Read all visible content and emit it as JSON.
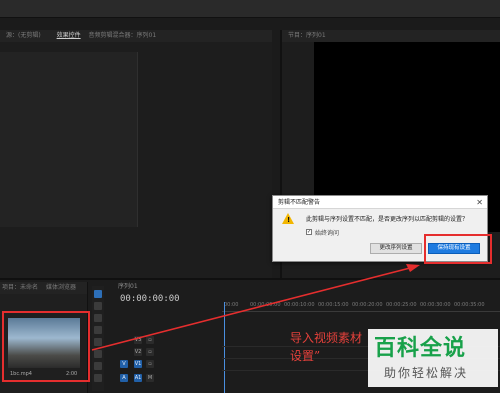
{
  "source_panel": {
    "tabs": [
      "效果控件",
      "音频剪辑混合器：序列01"
    ],
    "left_label": "源：(无剪辑)"
  },
  "program_panel": {
    "title": "节目：序列01"
  },
  "dialog": {
    "title": "剪辑不匹配警告",
    "close": "✕",
    "message": "此剪辑与序列设置不匹配，是否更改序列以匹配剪辑的设置？",
    "checkbox_label": "始终询问",
    "checkbox_checked": true,
    "btn_change": "更改序列设置",
    "btn_keep": "保持现有设置"
  },
  "project_panel": {
    "title": "项目：未命名",
    "tab2": "媒体浏览器",
    "clip_name": "1bc.mp4",
    "clip_duration": "2:00"
  },
  "timeline": {
    "title": "序列01",
    "timecode": "00:00:00:00",
    "ruler": [
      "00:00",
      "00:00:05:00",
      "00:00:10:00",
      "00:00:15:00",
      "00:00:20:00",
      "00:00:25:00",
      "00:00:30:00",
      "00:00:35:00",
      "00:00:40:00"
    ],
    "tracks": [
      "V3",
      "V2",
      "V1",
      "A1"
    ]
  },
  "annotation": {
    "line1": "导入视频素材",
    "line2": "设置”"
  },
  "watermark": {
    "title": "百科全说",
    "subtitle": "助你轻松解决"
  },
  "colors": {
    "accent": "#1e7be0",
    "annotation_red": "#e52e2e",
    "watermark_green": "#18a14a"
  }
}
